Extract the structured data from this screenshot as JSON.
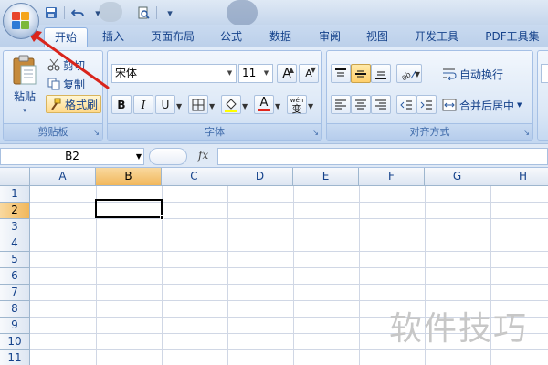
{
  "quick_access": {
    "save_icon": "save-icon",
    "undo_icon": "undo-icon",
    "print_preview_icon": "print-preview-icon"
  },
  "tabs": [
    {
      "label": "开始",
      "active": true
    },
    {
      "label": "插入"
    },
    {
      "label": "页面布局"
    },
    {
      "label": "公式"
    },
    {
      "label": "数据"
    },
    {
      "label": "审阅"
    },
    {
      "label": "视图"
    },
    {
      "label": "开发工具"
    },
    {
      "label": "PDF工具集"
    }
  ],
  "clipboard": {
    "paste_label": "粘贴",
    "cut_label": "剪切",
    "copy_label": "复制",
    "format_painter_label": "格式刷",
    "group_label": "剪贴板"
  },
  "font": {
    "font_name": "宋体",
    "font_size": "11",
    "grow_label": "A",
    "shrink_label": "A",
    "bold_label": "B",
    "italic_label": "I",
    "underline_label": "U",
    "font_color_label": "A",
    "phonetic_label": "wén",
    "phonetic_char": "变",
    "group_label": "字体"
  },
  "alignment": {
    "wrap_text_label": "自动换行",
    "merge_center_label": "合并后居中",
    "group_label": "对齐方式"
  },
  "formula_bar": {
    "name_box": "B2",
    "fx_label": "fx",
    "content": ""
  },
  "grid": {
    "columns": [
      "A",
      "B",
      "C",
      "D",
      "E",
      "F",
      "G",
      "H"
    ],
    "rows": [
      "1",
      "2",
      "3",
      "4",
      "5",
      "6",
      "7",
      "8",
      "9",
      "10",
      "11"
    ],
    "selected_cell": "B2"
  },
  "watermark": "软件技巧",
  "colors": {
    "accent": "#f1b75b",
    "ribbon": "#d5e3f5",
    "annotation_arrow": "#d9241b"
  }
}
